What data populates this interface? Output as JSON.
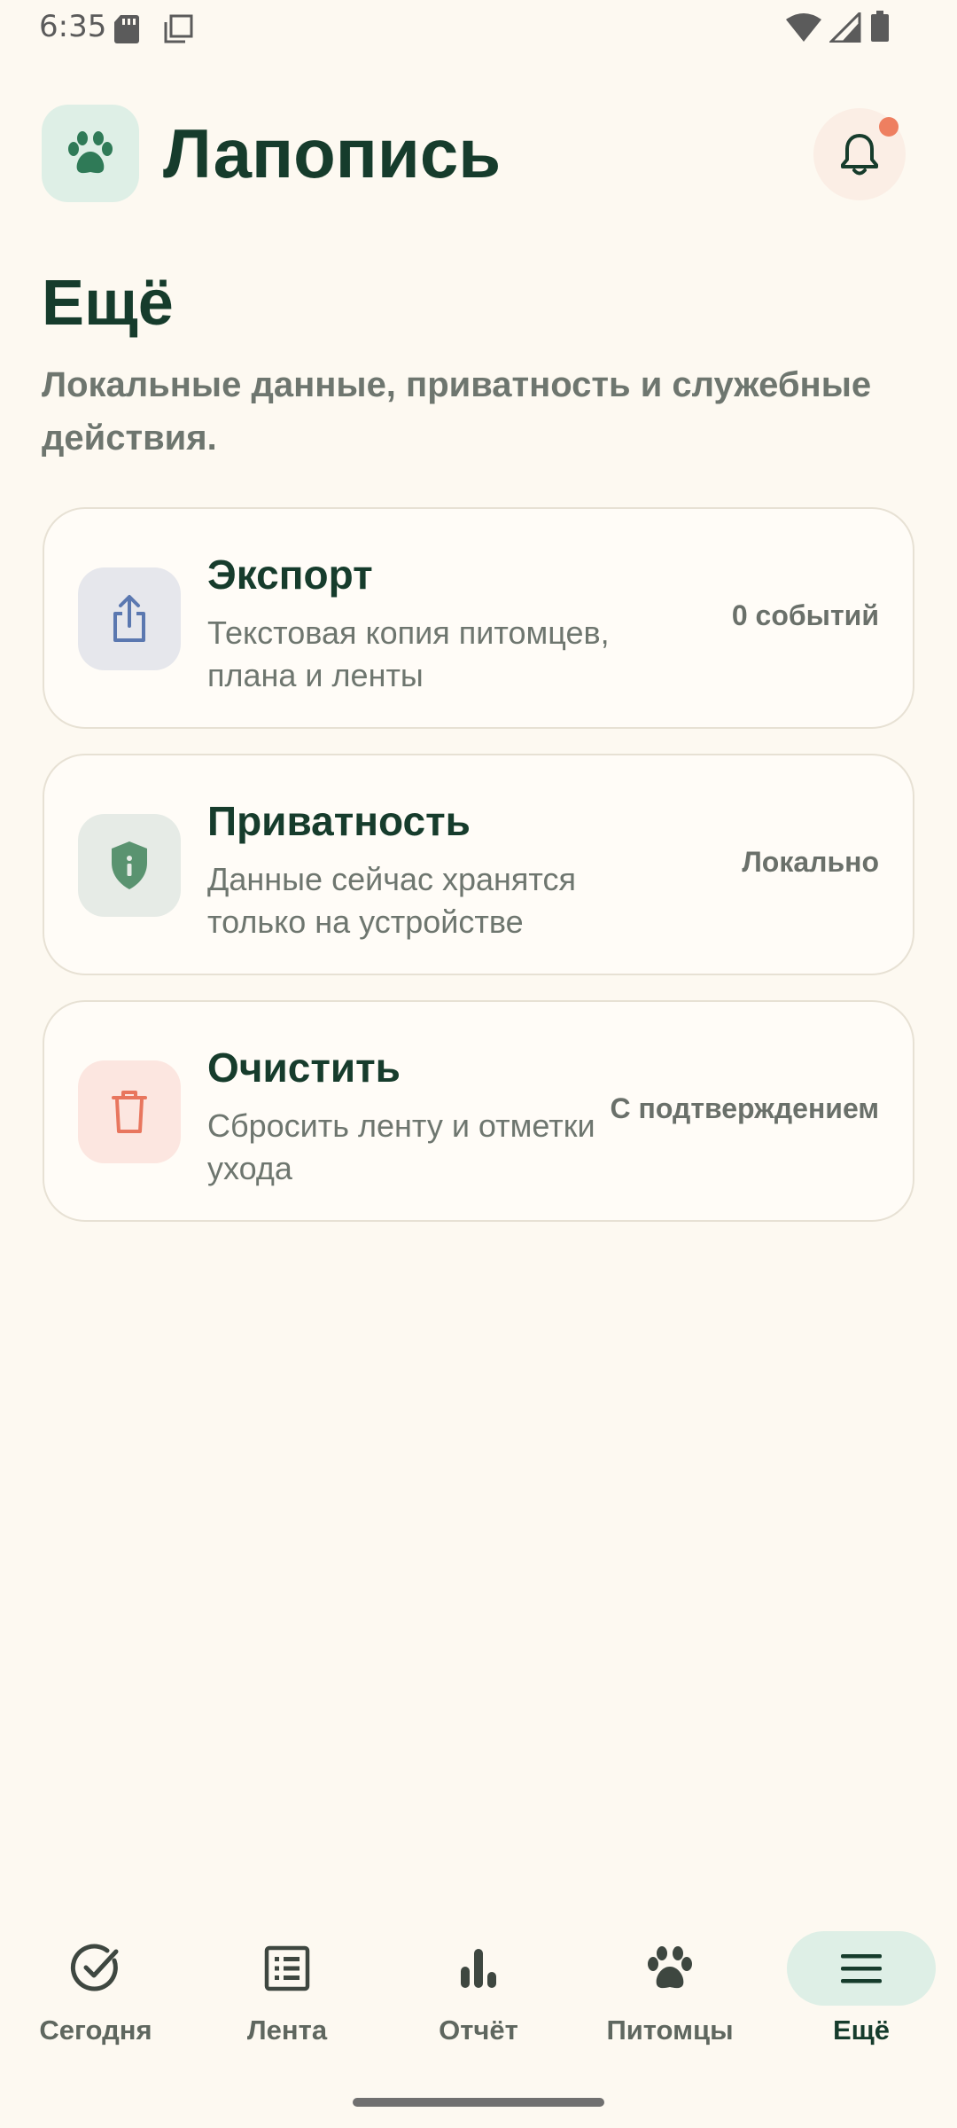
{
  "status_bar": {
    "time": "6:35",
    "icons": [
      "sd-card-icon",
      "copy-icon",
      "wifi-icon",
      "signal-icon",
      "battery-icon"
    ]
  },
  "header": {
    "app_title": "Лапопись",
    "logo_icon": "paw-icon",
    "notification_icon": "bell-icon",
    "has_notification_badge": true
  },
  "page": {
    "title": "Ещё",
    "subtitle": "Локальные данные, приватность и служебные действия."
  },
  "cards": [
    {
      "title": "Экспорт",
      "description": "Текстовая копия питомцев, плана и ленты",
      "meta": "0 событий",
      "icon": "share-icon"
    },
    {
      "title": "Приватность",
      "description": "Данные сейчас хранятся только на устройстве",
      "meta": "Локально",
      "icon": "shield-icon"
    },
    {
      "title": "Очистить",
      "description": "Сбросить ленту и отметки ухода",
      "meta": "С подтверждением",
      "icon": "trash-icon"
    }
  ],
  "bottom_nav": {
    "active": "Ещё",
    "items": [
      {
        "label": "Сегодня",
        "icon": "check-circle-icon"
      },
      {
        "label": "Лента",
        "icon": "list-icon"
      },
      {
        "label": "Отчёт",
        "icon": "bar-chart-icon"
      },
      {
        "label": "Питомцы",
        "icon": "paw-icon"
      },
      {
        "label": "Ещё",
        "icon": "menu-icon"
      }
    ]
  },
  "colors": {
    "background": "#FDF9F1",
    "primary_dark": "#163C2C",
    "accent_green": "#2F7A57",
    "export_blue": "#5B78B0",
    "danger_red": "#E8765E",
    "badge": "#EE7F60"
  }
}
